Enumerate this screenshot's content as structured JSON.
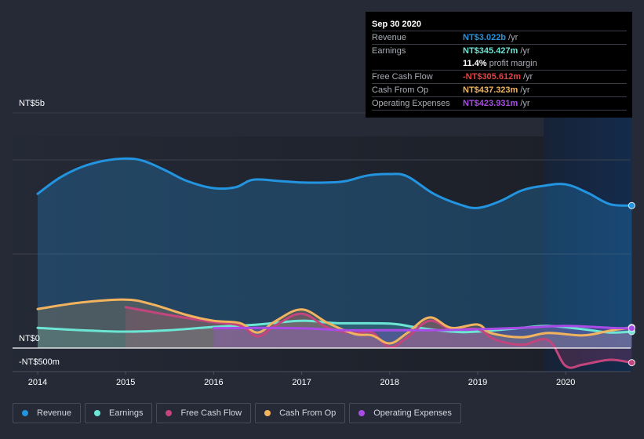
{
  "tooltip": {
    "date": "Sep 30 2020",
    "rows": [
      {
        "label": "Revenue",
        "value": "NT$3.022b",
        "unit": "/yr",
        "color": "#2394df"
      },
      {
        "label": "Earnings",
        "value": "NT$345.427m",
        "unit": "/yr",
        "color": "#6ce5d4"
      },
      {
        "label": "",
        "value": "11.4%",
        "unit": "profit margin",
        "color": "#ffffff"
      },
      {
        "label": "Free Cash Flow",
        "value": "-NT$305.612m",
        "unit": "/yr",
        "color": "#e84142"
      },
      {
        "label": "Cash From Op",
        "value": "NT$437.323m",
        "unit": "/yr",
        "color": "#f2b35e"
      },
      {
        "label": "Operating Expenses",
        "value": "NT$423.931m",
        "unit": "/yr",
        "color": "#a94ce6"
      }
    ]
  },
  "legend": [
    {
      "label": "Revenue",
      "color": "#2394df"
    },
    {
      "label": "Earnings",
      "color": "#6ce5d4"
    },
    {
      "label": "Free Cash Flow",
      "color": "#c4457d"
    },
    {
      "label": "Cash From Op",
      "color": "#f2b35e"
    },
    {
      "label": "Operating Expenses",
      "color": "#a94ce6"
    }
  ],
  "chart_data": {
    "type": "area",
    "title": "",
    "xlabel": "",
    "ylabel": "",
    "unit": "NT$ billions",
    "x_ticks": [
      "2014",
      "2015",
      "2016",
      "2017",
      "2018",
      "2019",
      "2020"
    ],
    "y_tick_labels": [
      {
        "value": 5,
        "label": "NT$5b"
      },
      {
        "value": 0,
        "label": "NT$0"
      },
      {
        "value": -0.5,
        "label": "-NT$500m"
      }
    ],
    "xlim": [
      2014,
      2020.75
    ],
    "ylim": [
      -0.5,
      5
    ],
    "gridlines": [
      5,
      4,
      2,
      0,
      -0.5
    ],
    "highlight_range": [
      2019.75,
      2020.75
    ],
    "series": [
      {
        "name": "Revenue",
        "color": "#2394df",
        "points": [
          [
            2014,
            3.28
          ],
          [
            2014.25,
            3.62
          ],
          [
            2014.5,
            3.85
          ],
          [
            2014.75,
            3.98
          ],
          [
            2015,
            4.03
          ],
          [
            2015.2,
            3.98
          ],
          [
            2015.45,
            3.78
          ],
          [
            2015.7,
            3.55
          ],
          [
            2016,
            3.4
          ],
          [
            2016.25,
            3.42
          ],
          [
            2016.45,
            3.58
          ],
          [
            2016.75,
            3.55
          ],
          [
            2017,
            3.52
          ],
          [
            2017.3,
            3.52
          ],
          [
            2017.5,
            3.55
          ],
          [
            2017.75,
            3.67
          ],
          [
            2018,
            3.7
          ],
          [
            2018.2,
            3.65
          ],
          [
            2018.5,
            3.28
          ],
          [
            2018.8,
            3.05
          ],
          [
            2019,
            2.98
          ],
          [
            2019.25,
            3.12
          ],
          [
            2019.5,
            3.35
          ],
          [
            2019.75,
            3.45
          ],
          [
            2020,
            3.48
          ],
          [
            2020.25,
            3.3
          ],
          [
            2020.5,
            3.06
          ],
          [
            2020.75,
            3.03
          ]
        ]
      },
      {
        "name": "Earnings",
        "color": "#6ce5d4",
        "points": [
          [
            2014,
            0.43
          ],
          [
            2014.5,
            0.38
          ],
          [
            2015,
            0.35
          ],
          [
            2015.5,
            0.38
          ],
          [
            2016,
            0.45
          ],
          [
            2016.5,
            0.5
          ],
          [
            2017,
            0.58
          ],
          [
            2017.4,
            0.53
          ],
          [
            2018,
            0.52
          ],
          [
            2018.3,
            0.44
          ],
          [
            2018.7,
            0.35
          ],
          [
            2019,
            0.35
          ],
          [
            2019.5,
            0.43
          ],
          [
            2019.8,
            0.47
          ],
          [
            2020.2,
            0.4
          ],
          [
            2020.5,
            0.33
          ],
          [
            2020.75,
            0.35
          ]
        ]
      },
      {
        "name": "Free Cash Flow",
        "color": "#c4457d",
        "points": [
          [
            2015,
            0.87
          ],
          [
            2015.5,
            0.7
          ],
          [
            2016,
            0.55
          ],
          [
            2016.3,
            0.48
          ],
          [
            2016.5,
            0.25
          ],
          [
            2016.7,
            0.48
          ],
          [
            2017,
            0.73
          ],
          [
            2017.3,
            0.43
          ],
          [
            2017.6,
            0.32
          ],
          [
            2017.8,
            0.33
          ],
          [
            2018,
            0.02
          ],
          [
            2018.2,
            0.23
          ],
          [
            2018.45,
            0.58
          ],
          [
            2018.7,
            0.4
          ],
          [
            2019,
            0.4
          ],
          [
            2019.2,
            0.18
          ],
          [
            2019.5,
            0.07
          ],
          [
            2019.8,
            0.17
          ],
          [
            2020,
            -0.38
          ],
          [
            2020.2,
            -0.35
          ],
          [
            2020.5,
            -0.25
          ],
          [
            2020.75,
            -0.31
          ]
        ]
      },
      {
        "name": "Cash From Op",
        "color": "#f2b35e",
        "points": [
          [
            2014,
            0.83
          ],
          [
            2014.5,
            0.97
          ],
          [
            2015,
            1.03
          ],
          [
            2015.3,
            0.93
          ],
          [
            2015.7,
            0.7
          ],
          [
            2016,
            0.58
          ],
          [
            2016.3,
            0.53
          ],
          [
            2016.5,
            0.33
          ],
          [
            2016.7,
            0.57
          ],
          [
            2017,
            0.82
          ],
          [
            2017.3,
            0.53
          ],
          [
            2017.6,
            0.3
          ],
          [
            2017.8,
            0.27
          ],
          [
            2018,
            0.1
          ],
          [
            2018.2,
            0.32
          ],
          [
            2018.45,
            0.65
          ],
          [
            2018.7,
            0.43
          ],
          [
            2019,
            0.5
          ],
          [
            2019.15,
            0.32
          ],
          [
            2019.5,
            0.23
          ],
          [
            2019.8,
            0.32
          ],
          [
            2020.2,
            0.27
          ],
          [
            2020.5,
            0.37
          ],
          [
            2020.75,
            0.44
          ]
        ]
      },
      {
        "name": "Operating Expenses",
        "color": "#a94ce6",
        "points": [
          [
            2016,
            0.42
          ],
          [
            2016.5,
            0.43
          ],
          [
            2017,
            0.42
          ],
          [
            2017.5,
            0.38
          ],
          [
            2018,
            0.38
          ],
          [
            2018.5,
            0.38
          ],
          [
            2019,
            0.4
          ],
          [
            2019.5,
            0.43
          ],
          [
            2020,
            0.47
          ],
          [
            2020.5,
            0.43
          ],
          [
            2020.75,
            0.42
          ]
        ]
      }
    ]
  }
}
